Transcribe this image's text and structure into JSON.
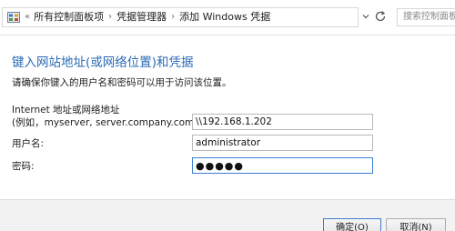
{
  "window": {
    "breadcrumb": {
      "overflow_glyph": "«",
      "items": [
        "所有控制面板项",
        "凭据管理器",
        "添加 Windows 凭据"
      ],
      "separator": "›"
    },
    "search": {
      "placeholder": "搜索控制面板"
    },
    "icons": {
      "control_panel": "control-panel-icon",
      "dropdown": "chevron-down-icon",
      "refresh": "refresh-icon"
    }
  },
  "form": {
    "heading": "键入网站地址(或网络位置)和凭据",
    "description": "请确保你键入的用户名和密码可以用于访问该位置。",
    "address_label_line1": "Internet 地址或网络地址",
    "address_label_line2": "(例如，myserver, server.company.com):",
    "address_value": "\\\\192.168.1.202",
    "username_label": "用户名:",
    "username_value": "administrator",
    "password_label": "密码:",
    "password_value": "●●●●●"
  },
  "footer": {
    "ok_label": "确定(O)",
    "cancel_label": "取消(N)"
  },
  "colors": {
    "heading": "#2a6bb6",
    "focus_border": "#3c7fd1",
    "footer_bg": "#f2f2f2"
  }
}
